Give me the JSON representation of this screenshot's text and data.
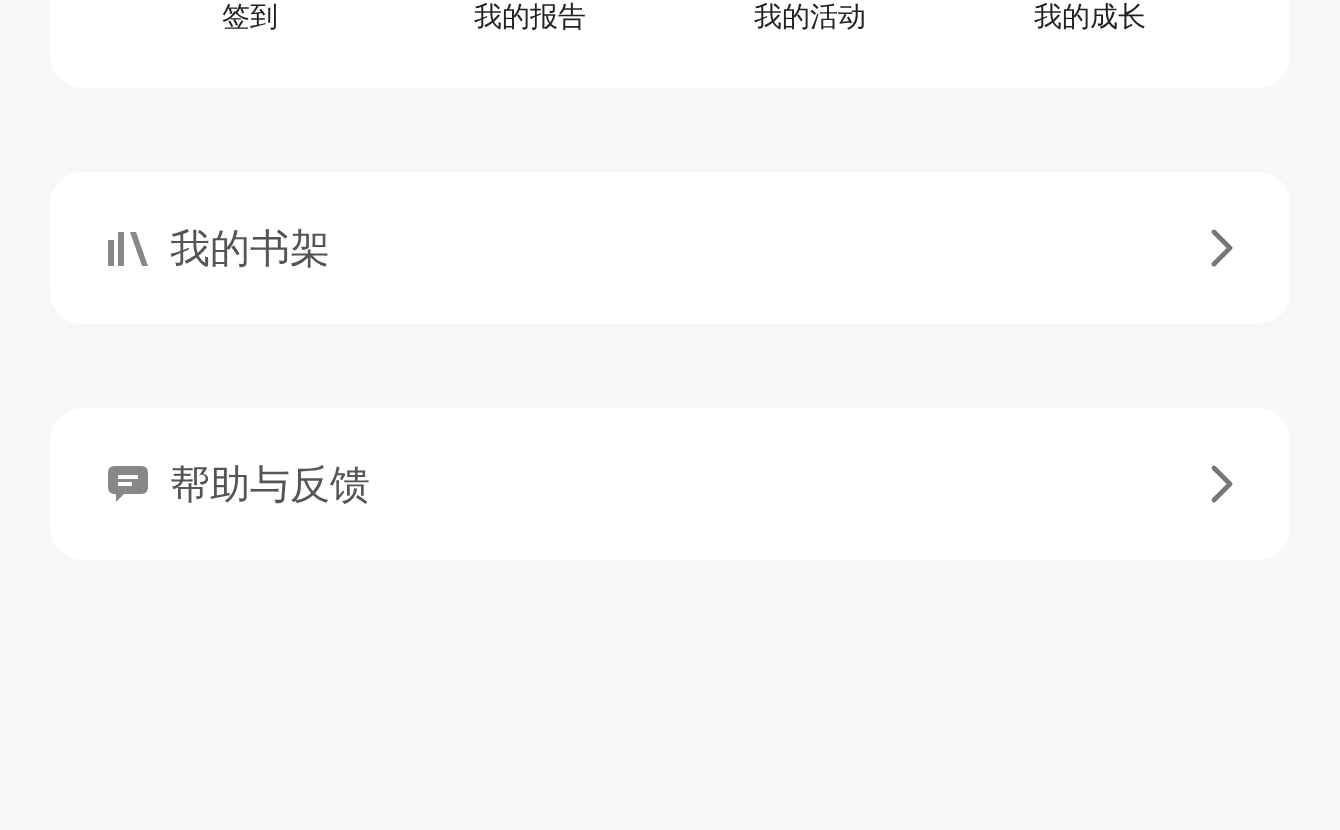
{
  "shortcuts": [
    {
      "label": "签到"
    },
    {
      "label": "我的报告"
    },
    {
      "label": "我的活动"
    },
    {
      "label": "我的成长"
    }
  ],
  "menu_items": [
    {
      "kind": "bookshelf",
      "label": "我的书架"
    },
    {
      "kind": "feedback",
      "label": "帮助与反馈"
    }
  ]
}
